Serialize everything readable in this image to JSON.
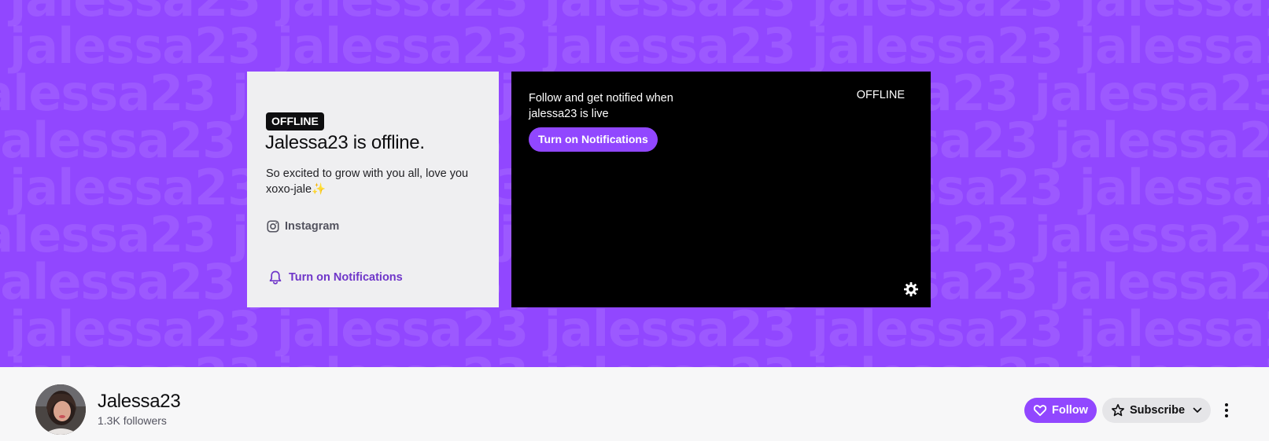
{
  "banner": {
    "watermark_text": "jalessa23",
    "background_color": "#9147ff"
  },
  "info_card": {
    "badge": "OFFLINE",
    "title": "Jalessa23 is offline.",
    "bio": "So excited to grow with you all, love you xoxo-jale✨",
    "social_link": "Instagram",
    "notifications_link": "Turn on Notifications"
  },
  "player": {
    "message": "Follow and get notified when jalessa23 is live",
    "notifications_button": "Turn on Notifications",
    "status": "OFFLINE"
  },
  "channel": {
    "name": "Jalessa23",
    "followers": "1.3K followers",
    "follow_label": "Follow",
    "subscribe_label": "Subscribe",
    "accent_color": "#9147ff"
  },
  "icons": {
    "instagram": "instagram-icon",
    "bell": "bell-icon",
    "gear": "gear-icon",
    "heart": "heart-icon",
    "star": "star-icon",
    "chevron": "chevron-down-icon",
    "more": "more-vertical-icon"
  }
}
